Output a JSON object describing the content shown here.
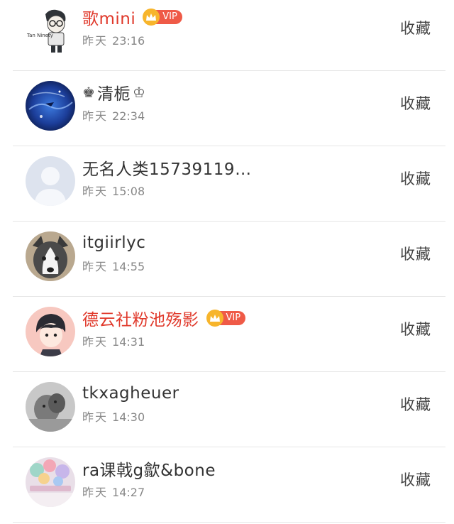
{
  "action_label": "收藏",
  "vip_label": "VIP",
  "rows": [
    {
      "name": "歌mini",
      "day": "昨天",
      "time": "23:16",
      "vip": true
    },
    {
      "name": "清栀",
      "day": "昨天",
      "time": "22:34",
      "vip": false,
      "prefix": "♚",
      "suffix": "♔"
    },
    {
      "name": "无名人类15739119…",
      "day": "昨天",
      "time": "15:08",
      "vip": false
    },
    {
      "name": "itgiirlyc",
      "day": "昨天",
      "time": "14:55",
      "vip": false
    },
    {
      "name": "德云社粉池殇影",
      "day": "昨天",
      "time": "14:31",
      "vip": true
    },
    {
      "name": "tkxagheuer",
      "day": "昨天",
      "time": "14:30",
      "vip": false
    },
    {
      "name": "ra课戟g歙&bone",
      "day": "昨天",
      "time": "14:27",
      "vip": false
    }
  ],
  "avatar_texts": {
    "row0": "Tan Ninety"
  },
  "colors": {
    "vip_name": "#e0392b",
    "vip_badge": "#ef5a47",
    "crown": "#f7b52c",
    "divider": "#e6e6e6"
  }
}
